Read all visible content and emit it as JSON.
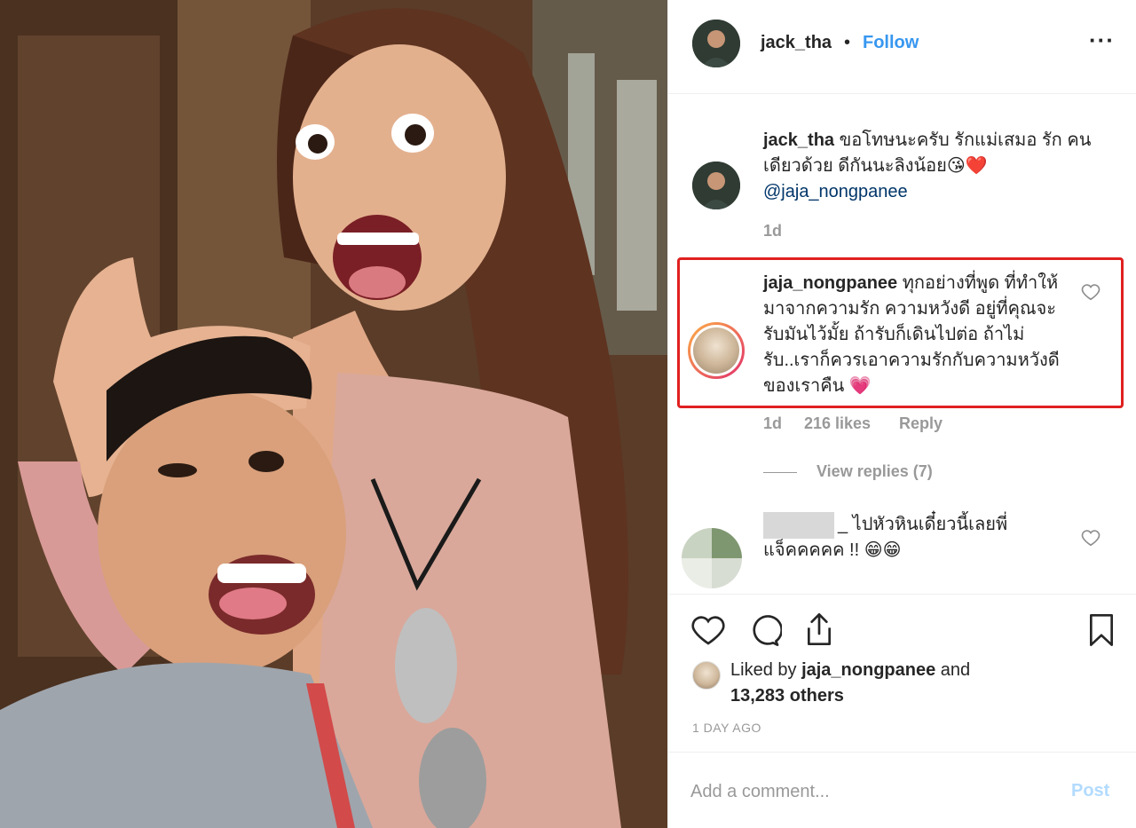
{
  "photo": {
    "alt_icon": "selfie-photo"
  },
  "header": {
    "username": "jack_tha",
    "separator": "•",
    "follow_label": "Follow",
    "more_label": "···"
  },
  "caption": {
    "username": "jack_tha",
    "text": "ขอโทษนะครับ รักแม่เสมอ รัก คนเดียวด้วย ดีกันนะลิงน้อย😘❤️",
    "mention": "@jaja_nongpanee",
    "age": "1d"
  },
  "comments": [
    {
      "username": "jaja_nongpanee",
      "text": "ทุกอย่างที่พูด ที่ทำให้มาจากความรัก ความหวังดี อยู่ที่คุณจะรับมันไว้มั้ย ถ้ารับก็เดินไปต่อ ถ้าไม่รับ..เราก็ควรเอาความรักกับความหวังดีของเราคืน 💗",
      "age": "1d",
      "likes": "216 likes",
      "reply_label": "Reply",
      "view_replies": "View replies (7)"
    },
    {
      "username": "",
      "text": "_ ไปหัวหินเดี๋ยวนี้เลยพี่ แจ็คคคคค !! 😁😁"
    }
  ],
  "actions": {
    "icons": [
      "heart-icon",
      "comment-icon",
      "share-icon",
      "bookmark-icon"
    ],
    "liked_by_prefix": "Liked by",
    "liked_by_user": "jaja_nongpanee",
    "liked_by_and": "and",
    "others": "13,283 others",
    "timestamp": "1 DAY AGO"
  },
  "add_comment": {
    "placeholder": "Add a comment...",
    "post_label": "Post"
  },
  "colors": {
    "link_blue": "#3897f0",
    "post_disabled": "#b3dbff",
    "highlight_red": "#e02020",
    "muted": "#999999"
  }
}
